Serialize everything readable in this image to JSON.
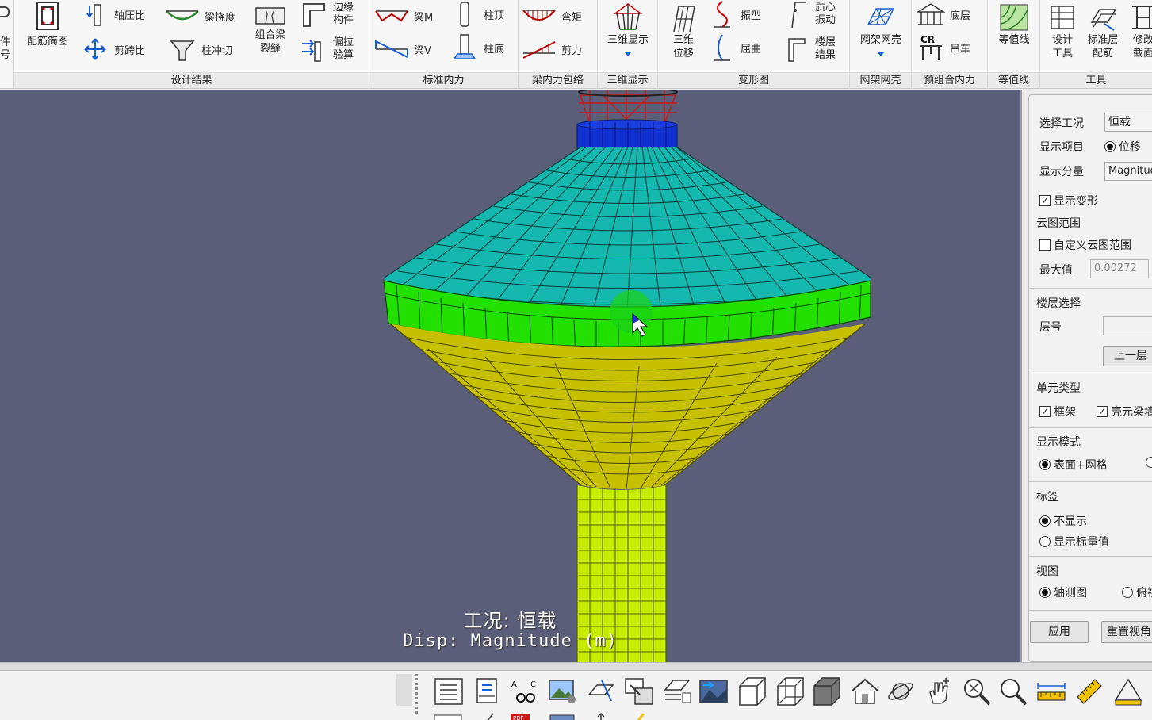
{
  "ribbon": {
    "partial_left": {
      "line1": "件",
      "line2": "号"
    },
    "groups": {
      "design": {
        "label": "设计结果",
        "peijin": "配筋简图",
        "zhouyabi": "轴压比",
        "jiankuabi": "剪跨比",
        "liangnaodu": "梁挠度",
        "zhuchongqie": "柱冲切",
        "zuheliang": {
          "l1": "组合梁",
          "l2": "裂缝"
        },
        "bianyuan": {
          "l1": "边缘",
          "l2": "构件"
        },
        "pianla": {
          "l1": "偏拉",
          "l2": "验算"
        }
      },
      "std_force": {
        "label": "标准内力",
        "liangM": "梁M",
        "liangV": "梁V",
        "zhuding": "柱顶",
        "zhudi": "柱底"
      },
      "envelope": {
        "label": "梁内力包络",
        "wanju": "弯矩",
        "jianli": "剪力"
      },
      "display3d": {
        "label": "三维显示",
        "btn": "三维显示"
      },
      "deform": {
        "label": "变形图",
        "weiyi": {
          "l1": "三维",
          "l2": "位移"
        },
        "zhenxing": "振型",
        "ququ": "屈曲",
        "zhixin": {
          "l1": "质心",
          "l2": "振动"
        },
        "louceng": {
          "l1": "楼层",
          "l2": "结果"
        }
      },
      "shell": {
        "label": "网架网壳",
        "btn": "网架网壳"
      },
      "precomb": {
        "label": "预组合内力",
        "dicen": "底层",
        "diaoche": "吊车"
      },
      "contour": {
        "label": "等值线",
        "btn": "等值线"
      },
      "tools": {
        "label": "工具",
        "sheji": {
          "l1": "设计",
          "l2": "工具"
        },
        "biaozhun": {
          "l1": "标准层",
          "l2": "配筋"
        },
        "xiugai": {
          "l1": "修改",
          "l2": "截面"
        }
      }
    }
  },
  "viewport": {
    "case_label": "工况: 恒载",
    "disp_label": "Disp: Magnitude (m)"
  },
  "panel": {
    "case_label": "选择工况",
    "case_value": "恒载",
    "item_label": "显示项目",
    "item_option": "位移",
    "component_label": "显示分量",
    "component_value": "Magnitude",
    "show_deform": "显示变形",
    "cloud_range": "云图范围",
    "custom_range": "自定义云图范围",
    "max_label": "最大值",
    "max_value": "0.00272",
    "floor_select": "楼层选择",
    "floor_no": "层号",
    "floor_value": "",
    "prev_floor": "上一层",
    "elem_type": "单元类型",
    "frame": "框架",
    "shell_beam": "壳元梁墙",
    "display_mode": "显示模式",
    "surface_mesh": "表面+网格",
    "tag": "标签",
    "tag_none": "不显示",
    "tag_scalar": "显示标量值",
    "view": "视图",
    "view_axis": "轴测图",
    "view_top": "俯视图",
    "apply": "应用",
    "reset": "重置视角"
  },
  "colors": {
    "viewport_bg": "#5a5e78",
    "top_cap": "#1030d0",
    "cone_top": "#11b8b0",
    "ring": "#22e000",
    "cone_bottom": "#c6c000",
    "shaft": "#c8ec00"
  }
}
